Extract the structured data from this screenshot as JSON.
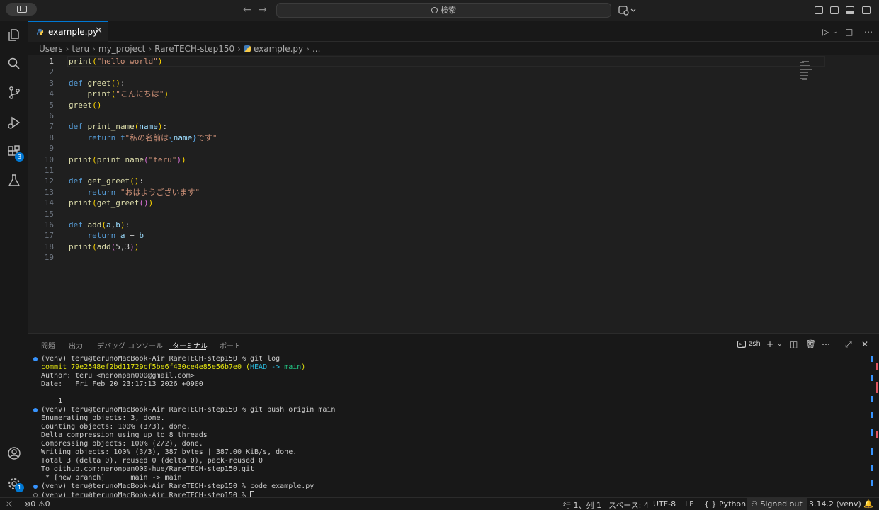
{
  "titlebar": {
    "search_placeholder": "検索"
  },
  "tab": {
    "label": "example.py",
    "close": "✕"
  },
  "breadcrumb": [
    "Users",
    "teru",
    "my_project",
    "RareTECH-step150",
    "example.py",
    "..."
  ],
  "editor": {
    "line_numbers": [
      "1",
      "2",
      "3",
      "4",
      "5",
      "6",
      "7",
      "8",
      "9",
      "10",
      "11",
      "12",
      "13",
      "14",
      "15",
      "16",
      "17",
      "18",
      "19"
    ],
    "lines": [
      "print(\"hello world\")",
      "",
      "def greet():",
      "    print(\"こんにちは\")",
      "greet()",
      "",
      "def print_name(name):",
      "    return f\"私の名前は{name}です\"",
      "",
      "print(print_name(\"teru\"))",
      "",
      "def get_greet():",
      "    return \"おはようございます\"",
      "print(get_greet())",
      "",
      "def add(a,b):",
      "    return a + b",
      "print(add(5,3))",
      ""
    ]
  },
  "panel": {
    "tabs": [
      "問題",
      "出力",
      "デバッグ コンソール",
      "ターミナル",
      "ポート"
    ],
    "active_tab": "ターミナル",
    "shell": "zsh"
  },
  "terminal": {
    "lines": [
      "(venv) teru@terunoMacBook-Air RareTECH-step150 % git log",
      "commit 79e2548ef2bd11729cf5be6f430ce4e85e56b7e0 (HEAD -> main)",
      "Author: teru <meronpan000@gmail.com>",
      "Date:   Fri Feb 20 23:17:13 2026 +0900",
      "",
      "    1",
      "(venv) teru@terunoMacBook-Air RareTECH-step150 % git push origin main",
      "Enumerating objects: 3, done.",
      "Counting objects: 100% (3/3), done.",
      "Delta compression using up to 8 threads",
      "Compressing objects: 100% (2/2), done.",
      "Writing objects: 100% (3/3), 387 bytes | 387.00 KiB/s, done.",
      "Total 3 (delta 0), reused 0 (delta 0), pack-reused 0",
      "To github.com:meronpan000-hue/RareTECH-step150.git",
      " * [new branch]      main -> main",
      "(venv) teru@terunoMacBook-Air RareTECH-step150 % code example.py",
      "(venv) teru@terunoMacBook-Air RareTECH-step150 % "
    ]
  },
  "activity": {
    "extensions_badge": "3",
    "accounts_badge": "1"
  },
  "statusbar": {
    "errors": "0",
    "warnings": "0",
    "position": "行 1、列 1",
    "spaces": "スペース: 4",
    "encoding": "UTF-8",
    "eol": "LF",
    "language": "Python",
    "braces": "{ }",
    "signed_out": "Signed out",
    "interpreter": "3.14.2 (venv)"
  },
  "colors": {
    "accent": "#0078d4",
    "keyword": "#569cd6",
    "function": "#dcdcaa",
    "string": "#ce9178",
    "param": "#9cdcfe"
  }
}
